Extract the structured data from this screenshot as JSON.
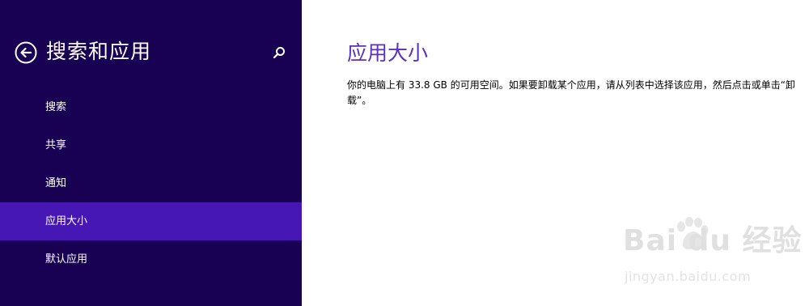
{
  "sidebar": {
    "title": "搜索和应用",
    "back_icon": "back-arrow-circle-icon",
    "search_icon": "search-icon",
    "items": [
      {
        "label": "搜索"
      },
      {
        "label": "共享"
      },
      {
        "label": "通知"
      },
      {
        "label": "应用大小",
        "selected": true
      },
      {
        "label": "默认应用"
      }
    ]
  },
  "main": {
    "title": "应用大小",
    "description": "你的电脑上有 33.8 GB 的可用空间。如果要卸载某个应用，请从列表中选择该应用，然后点击或单击“卸载”。"
  },
  "watermark": {
    "logo_text": "Bai du 经验",
    "url": "jingyan.baidu.com"
  },
  "colors": {
    "sidebar_background": "#180052",
    "selected_item_background": "#4617b4",
    "accent_title": "#5b2fc1",
    "main_background": "#ffffff"
  }
}
